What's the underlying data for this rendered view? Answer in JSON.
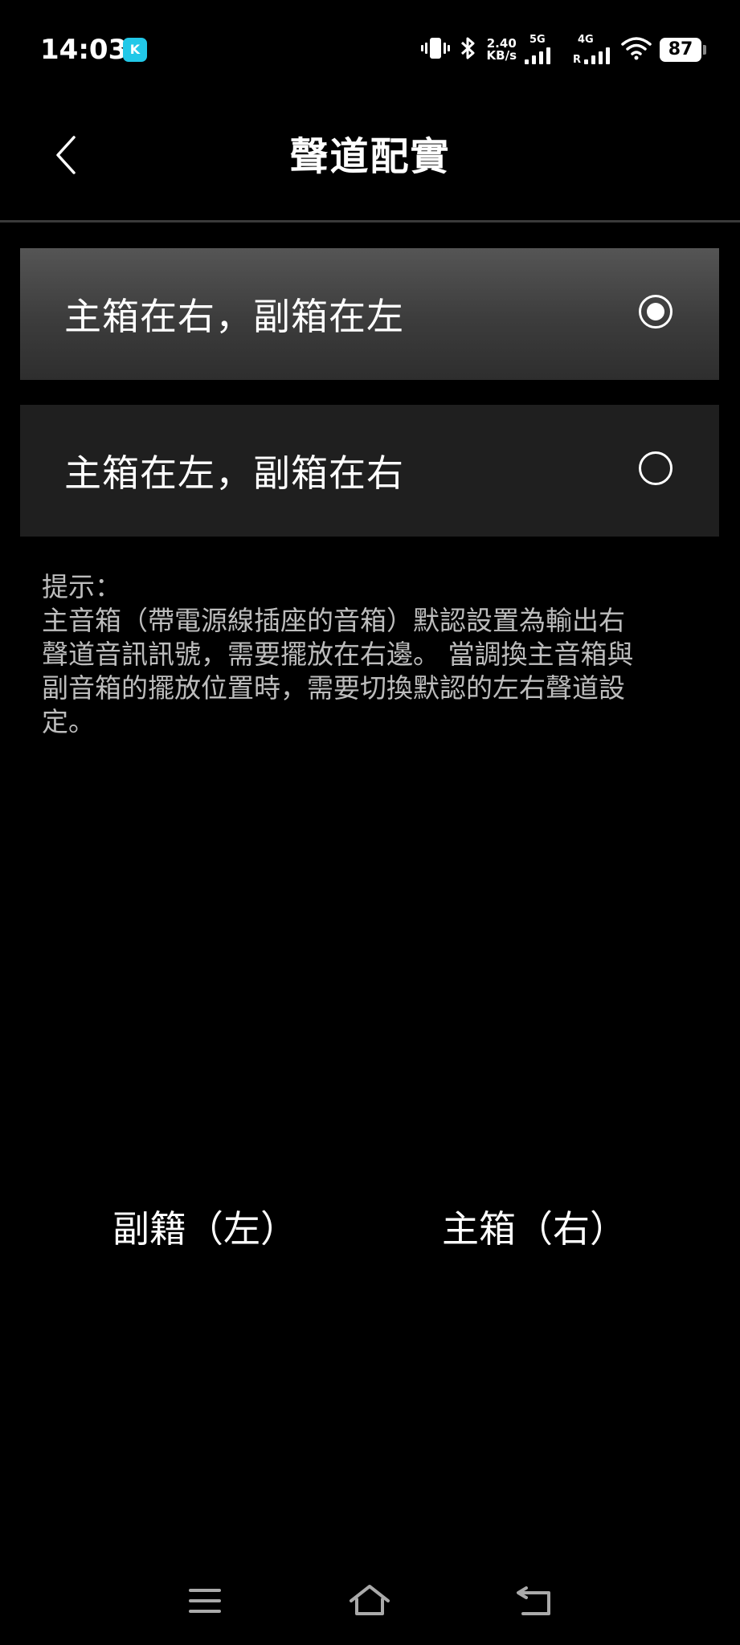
{
  "status_bar": {
    "time": "14:03",
    "app_badge": "K",
    "speed_value": "2.40",
    "speed_unit": "KB/s",
    "sim1_network": "5G",
    "sim2_network": "4G",
    "sim2_roaming": "R",
    "battery": "87",
    "icons": [
      "vibrate-icon",
      "bluetooth-icon",
      "signal-icon",
      "wifi-icon",
      "battery-icon"
    ]
  },
  "header": {
    "title": "聲道配實",
    "back_icon": "chevron-left-icon"
  },
  "options": [
    {
      "label": "主箱在右，副箱在左",
      "selected": true
    },
    {
      "label": "主箱在左，副箱在右",
      "selected": false
    }
  ],
  "hint": {
    "title": "提示：",
    "body": "主音箱（帶電源線插座的音箱）默認設置為輸出右\n聲道音訊訊號，需要擺放在右邊。 當調換主音箱與\n副音箱的擺放位置時，需要切換默認的左右聲道設\n定。"
  },
  "speakers": {
    "left": "副籍（左）",
    "right": "主箱（右）"
  },
  "nav_bar": {
    "icons": [
      "menu-icon",
      "home-icon",
      "back-icon"
    ]
  },
  "colors": {
    "background": "#000000",
    "selected_option": "#3c3c3c",
    "unselected_option": "#1f1f1f",
    "hint_text": "#bdbdbd",
    "app_badge": "#22c8e8"
  }
}
